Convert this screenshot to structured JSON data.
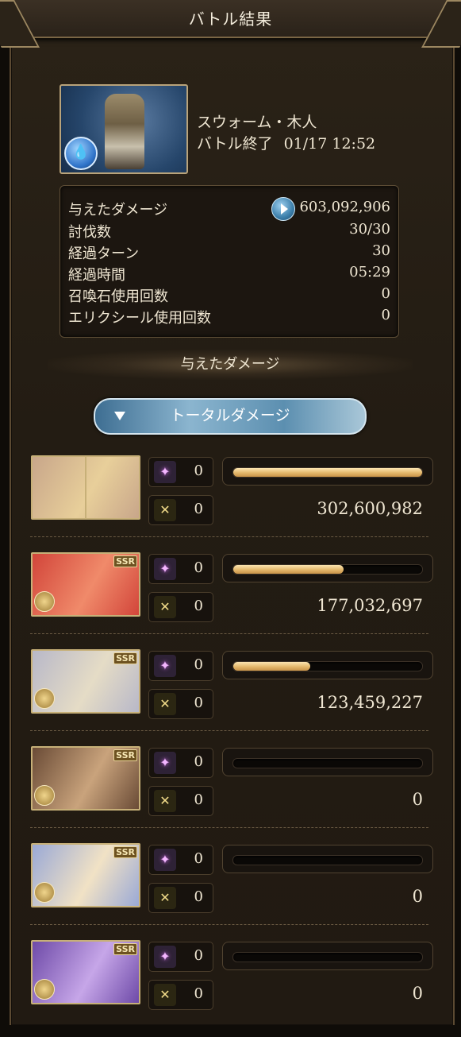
{
  "title": "バトル結果",
  "enemy": {
    "name": "スウォーム・木人",
    "status_label": "バトル終了",
    "timestamp": "01/17 12:52",
    "element_icon": "water-element-icon"
  },
  "stats": [
    {
      "label": "与えたダメージ",
      "value": "603,092,906"
    },
    {
      "label": "討伐数",
      "value": "30/30"
    },
    {
      "label": "経過ターン",
      "value": "30"
    },
    {
      "label": "経過時間",
      "value": "05:29"
    },
    {
      "label": "召喚石使用回数",
      "value": "0"
    },
    {
      "label": "エリクシール使用回数",
      "value": "0"
    }
  ],
  "section_title": "与えたダメージ",
  "dropdown": {
    "label": "トータルダメージ"
  },
  "characters": [
    {
      "name": "main-character",
      "ssr": false,
      "star_count": "0",
      "ougi_count": "0",
      "damage": "302,600,982",
      "ratio": 1.0,
      "colors": [
        "#c8a68a",
        "#e8cf9a"
      ]
    },
    {
      "name": "character-2",
      "ssr": true,
      "ssr_label": "SSR",
      "star_count": "0",
      "ougi_count": "0",
      "damage": "177,032,697",
      "ratio": 0.585,
      "colors": [
        "#d2453a",
        "#f08a6a"
      ]
    },
    {
      "name": "character-3",
      "ssr": true,
      "ssr_label": "SSR",
      "star_count": "0",
      "ougi_count": "0",
      "damage": "123,459,227",
      "ratio": 0.408,
      "colors": [
        "#b8b8c8",
        "#e5dcc6"
      ]
    },
    {
      "name": "character-4",
      "ssr": true,
      "ssr_label": "SSR",
      "star_count": "0",
      "ougi_count": "0",
      "damage": "0",
      "ratio": 0,
      "colors": [
        "#6a4b36",
        "#c9a37c"
      ]
    },
    {
      "name": "character-5",
      "ssr": true,
      "ssr_label": "SSR",
      "star_count": "0",
      "ougi_count": "0",
      "damage": "0",
      "ratio": 0,
      "colors": [
        "#9aa9d6",
        "#f1e2c5"
      ]
    },
    {
      "name": "character-6",
      "ssr": true,
      "ssr_label": "SSR",
      "star_count": "0",
      "ougi_count": "0",
      "damage": "0",
      "ratio": 0,
      "colors": [
        "#6e4aa8",
        "#c6a6e8"
      ]
    }
  ]
}
